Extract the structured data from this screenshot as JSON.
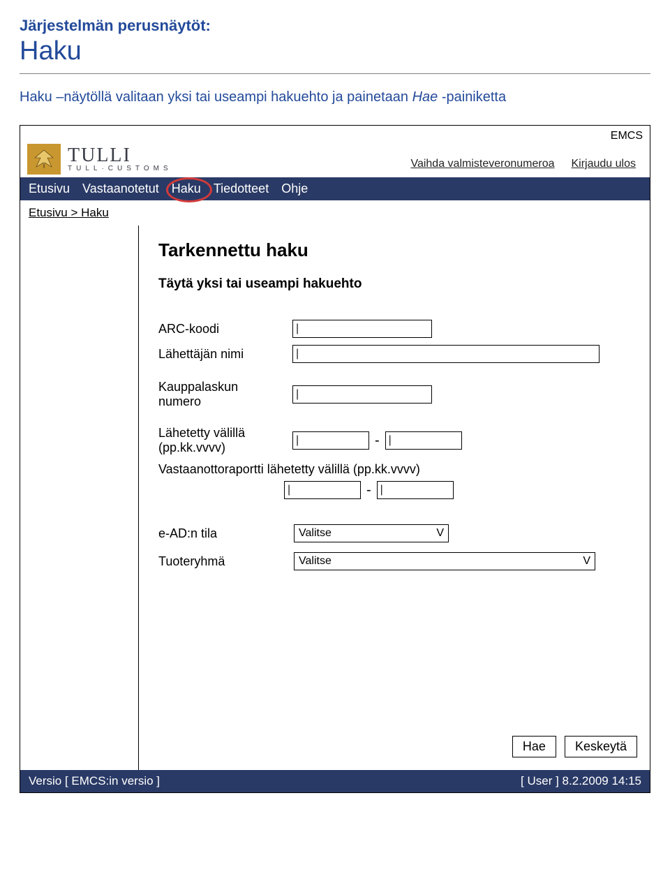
{
  "header": {
    "pretitle": "Järjestelmän perusnäytöt:",
    "title": "Haku",
    "intro_plain": "Haku –näytöllä valitaan yksi tai useampi hakuehto ja painetaan ",
    "intro_italic": "Hae",
    "intro_after": " -painiketta"
  },
  "toplinks": {
    "system": "EMCS",
    "change_tax_number": "Vaihda valmisteveronumeroa",
    "logout": "Kirjaudu ulos"
  },
  "logo": {
    "main": "TULLI",
    "sub": "TULL·CUSTOMS"
  },
  "nav": {
    "items": [
      "Etusivu",
      "Vastaanotetut",
      "Haku",
      "Tiedotteet",
      "Ohje"
    ]
  },
  "breadcrumb": "Etusivu > Haku",
  "main": {
    "title": "Tarkennettu haku",
    "subtitle": "Täytä yksi tai useampi hakuehto",
    "labels": {
      "arc": "ARC-koodi",
      "sender": "Lähettäjän nimi",
      "invoice": "Kauppalaskun numero",
      "sent_between": "Lähetetty välillä (pp.kk.vvvv)",
      "receipt_between": "Vastaanottoraportti lähetetty välillä (pp.kk.vvvv)",
      "ead_state": "e-AD:n tila",
      "product_group": "Tuoteryhmä"
    },
    "values": {
      "arc": "|",
      "sender": "|",
      "invoice": "|",
      "sent_from": "|",
      "sent_to": "|",
      "receipt_from": "|",
      "receipt_to": "|",
      "ead_state": "Valitse",
      "product_group": "Valitse"
    },
    "select_caret": "V",
    "dash": "-"
  },
  "buttons": {
    "search": "Hae",
    "cancel": "Keskeytä"
  },
  "footer": {
    "version": "Versio [ EMCS:in versio ]",
    "user": "[ User ] 8.2.2009 14:15"
  }
}
